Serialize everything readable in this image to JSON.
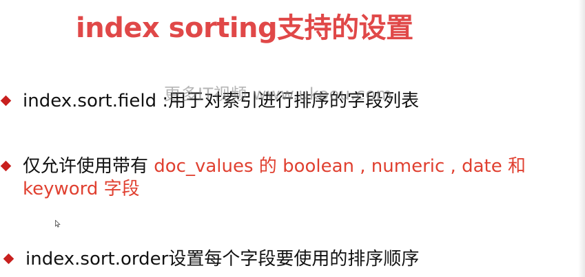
{
  "slide": {
    "title": "index sorting支持的设置",
    "bullets": [
      {
        "text": "index.sort.field :用于对索引进行排序的字段列表"
      },
      {
        "line1_black": "仅允许使用带有 ",
        "line1_red": "doc_values 的 boolean , numeric , date 和",
        "line2_red": "keyword 字段"
      },
      {
        "text": "index.sort.order设置每个字段要使用的排序顺序"
      }
    ],
    "watermark": "更多IT视频  www.ukoou.com"
  },
  "colors": {
    "title": "#e04848",
    "bullet": "#c8201e",
    "highlight": "#e04030",
    "body_text": "#111111"
  },
  "icons": {
    "bullet": "diamond-bullet-icon",
    "cursor": "mouse-pointer-icon"
  }
}
